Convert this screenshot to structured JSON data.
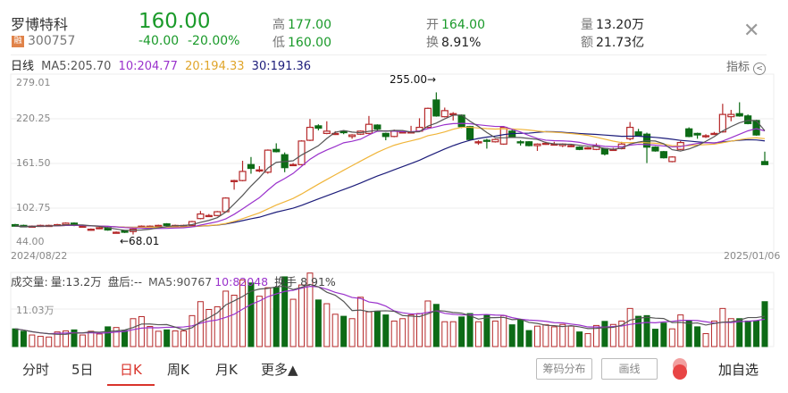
{
  "header": {
    "name": "罗博特科",
    "badge": "融",
    "code": "300757",
    "price": "160.00",
    "change": "-40.00",
    "change_pct": "-20.00%",
    "high_label": "高",
    "high": "177.00",
    "low_label": "低",
    "low": "160.00",
    "open_label": "开",
    "open": "164.00",
    "turnover_label": "换",
    "turnover": "8.91%",
    "volume_label": "量",
    "volume": "13.20万",
    "amount_label": "额",
    "amount": "21.73亿",
    "close_icon": "close-icon"
  },
  "ma_row": {
    "period": "日线",
    "ma5": "MA5:205.70",
    "ma10": "10:204.77",
    "ma20": "20:194.33",
    "ma30": "30:191.36",
    "indicator_label": "指标",
    "indicator_icon": "chevron-left-circle-icon"
  },
  "volume_row": {
    "title": "成交量:",
    "vol": "量:13.2万",
    "after_hours": "盘后:--",
    "ma5": "MA5:90767",
    "ma10": "10:82048",
    "turnover": "换手 8.91%"
  },
  "colors": {
    "up": "#b5292a",
    "down": "#0d6b16",
    "ma5": "#555555",
    "ma10": "#9a32cc",
    "ma20": "#f0b53a",
    "ma30": "#1c1c7a",
    "accent": "#d9342b",
    "price_green": "#1a9a2a"
  },
  "chart_data": {
    "type": "candlestick",
    "price_axis": {
      "labels": [
        "279.01",
        "220.25",
        "161.50",
        "102.75",
        "44.00"
      ],
      "range": [
        44.0,
        279.01
      ]
    },
    "date_labels": [
      "2024/08/22",
      "2025/01/06"
    ],
    "annotations": {
      "max": "255.00→",
      "min": "←68.01"
    },
    "volume_axis": {
      "label": "11.03万",
      "value": 11.03,
      "unit": "万"
    },
    "candles": [
      [
        81,
        82,
        79,
        79
      ],
      [
        80,
        81,
        78,
        78
      ],
      [
        79,
        80,
        78,
        79
      ],
      [
        79,
        81,
        78,
        80
      ],
      [
        79,
        81,
        79,
        80
      ],
      [
        81,
        82,
        80,
        81
      ],
      [
        81,
        84,
        80,
        83
      ],
      [
        83,
        84,
        79,
        80
      ],
      [
        79,
        80,
        78,
        79
      ],
      [
        74,
        76,
        73,
        75
      ],
      [
        76,
        78,
        75,
        77
      ],
      [
        77,
        78,
        73,
        74
      ],
      [
        71,
        72,
        70,
        71
      ],
      [
        73,
        74,
        70,
        71
      ],
      [
        72,
        76,
        68.01,
        75
      ],
      [
        79,
        80,
        78,
        79
      ],
      [
        79,
        80,
        78,
        79
      ],
      [
        79,
        81,
        78,
        80
      ],
      [
        82,
        83,
        79,
        80
      ],
      [
        80,
        81,
        79,
        80
      ],
      [
        80,
        81,
        79,
        80
      ],
      [
        80,
        86,
        79,
        85
      ],
      [
        89,
        99,
        88,
        95
      ],
      [
        93,
        95,
        92,
        93
      ],
      [
        93,
        99,
        92,
        98
      ],
      [
        98,
        117,
        97,
        116
      ],
      [
        139,
        140,
        127,
        139
      ],
      [
        139,
        165,
        138,
        151
      ],
      [
        160,
        170,
        148,
        155
      ],
      [
        153,
        158,
        150,
        153
      ],
      [
        150,
        180,
        148,
        179
      ],
      [
        180,
        188,
        176,
        177
      ],
      [
        173,
        176,
        150,
        156
      ],
      [
        160,
        162,
        158,
        160
      ],
      [
        160,
        192,
        159,
        191
      ],
      [
        192,
        220,
        191,
        209
      ],
      [
        211,
        213,
        205,
        208
      ],
      [
        201,
        217,
        200,
        204
      ],
      [
        201,
        204,
        199,
        201
      ],
      [
        204,
        205,
        200,
        202
      ],
      [
        197,
        200,
        194,
        199
      ],
      [
        200,
        205,
        199,
        204
      ],
      [
        201,
        224,
        200,
        213
      ],
      [
        212,
        213,
        205,
        207
      ],
      [
        201,
        202,
        192,
        197
      ],
      [
        197,
        206,
        196,
        204
      ],
      [
        203,
        204,
        202,
        203
      ],
      [
        203,
        211,
        202,
        203
      ],
      [
        204,
        221,
        203,
        209
      ],
      [
        209,
        235,
        208,
        234
      ],
      [
        245,
        255,
        223,
        224
      ],
      [
        223,
        235,
        222,
        231
      ],
      [
        227,
        229,
        218,
        227
      ],
      [
        225,
        226,
        208,
        210
      ],
      [
        210,
        211,
        192,
        193
      ],
      [
        190,
        192,
        186,
        190
      ],
      [
        192,
        194,
        181,
        191
      ],
      [
        190,
        194,
        189,
        193
      ],
      [
        187,
        210,
        186,
        209
      ],
      [
        204,
        206,
        195,
        196
      ],
      [
        190,
        192,
        185,
        189
      ],
      [
        190,
        191,
        184,
        185
      ],
      [
        185,
        188,
        178,
        187
      ],
      [
        188,
        190,
        186,
        188
      ],
      [
        187,
        190,
        185,
        187
      ],
      [
        185,
        188,
        183,
        187
      ],
      [
        185,
        187,
        183,
        185
      ],
      [
        183,
        184,
        179,
        180
      ],
      [
        182,
        183,
        180,
        182
      ],
      [
        180,
        188,
        179,
        185
      ],
      [
        181,
        182,
        172,
        174
      ],
      [
        180,
        182,
        178,
        180
      ],
      [
        181,
        190,
        180,
        187
      ],
      [
        194,
        216,
        192,
        209
      ],
      [
        203,
        207,
        197,
        198
      ],
      [
        200,
        202,
        162,
        183
      ],
      [
        183,
        184,
        177,
        178
      ],
      [
        177,
        178,
        168,
        169
      ],
      [
        164,
        171,
        163,
        170
      ],
      [
        180,
        191,
        179,
        189
      ],
      [
        207,
        209,
        196,
        197
      ],
      [
        201,
        202,
        194,
        199
      ],
      [
        198,
        200,
        195,
        198
      ],
      [
        200,
        203,
        199,
        201
      ],
      [
        203,
        240,
        202,
        226
      ],
      [
        223,
        232,
        217,
        226
      ],
      [
        227,
        242,
        223,
        224
      ],
      [
        224,
        226,
        213,
        214
      ],
      [
        218,
        219,
        198,
        199
      ],
      [
        164,
        177,
        160,
        160
      ]
    ],
    "volumes_wan": [
      5.2,
      4.5,
      3.4,
      3.0,
      2.8,
      4.3,
      4.6,
      4.9,
      3.4,
      4.5,
      3.7,
      5.8,
      5.6,
      4.7,
      8.2,
      8.8,
      5.9,
      4.5,
      4.9,
      4.6,
      4.6,
      9.1,
      13.2,
      10.9,
      11.7,
      16.3,
      15.1,
      19.6,
      18.7,
      14.8,
      17.3,
      17.3,
      20.5,
      13.9,
      18.1,
      21.6,
      13.7,
      12.6,
      9.5,
      8.9,
      8.2,
      14.5,
      10.2,
      10.4,
      9.3,
      7.5,
      8.2,
      9.3,
      9.7,
      13.4,
      12.4,
      7.3,
      7.3,
      8.7,
      9.7,
      7.3,
      9.3,
      7.5,
      9.1,
      6.4,
      7.8,
      4.7,
      6.0,
      6.4,
      5.8,
      6.5,
      6.0,
      4.3,
      3.8,
      6.2,
      7.4,
      6.5,
      7.5,
      11.2,
      8.9,
      9.1,
      5.1,
      6.9,
      5.2,
      9.3,
      7.5,
      5.8,
      3.8,
      7.5,
      11.2,
      8.2,
      8.2,
      7.5,
      7.5,
      13.2
    ]
  },
  "bottom_bar": {
    "tabs": [
      "分时",
      "5日",
      "日K",
      "周K",
      "月K",
      "更多▲"
    ],
    "active_tab": "日K",
    "chip_button": "筹码分布",
    "draw_button": "画线",
    "add_favorite": "加自选"
  }
}
